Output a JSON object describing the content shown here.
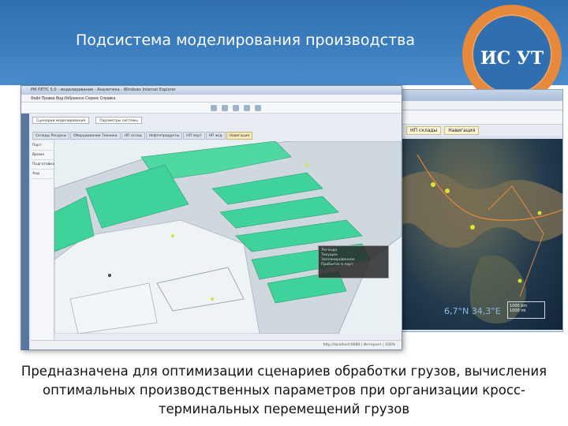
{
  "slide": {
    "title": "Подсистема моделирования производства",
    "logo_text": "ИС УТ",
    "caption": "Предназначена для оптимизации сценариев обработки грузов, вычисления оптимальных производственных параметров при организации кросс-терминальных перемещений грузов"
  },
  "colors": {
    "header_blue": "#3e7fc0",
    "logo_orange": "#e8883a",
    "map_green": "#3fd39b"
  },
  "front_window": {
    "title": "РМ ППТС 5.0 - моделирование - Аналитика - Windows Internet Explorer",
    "menu": "Файл  Правка  Вид  Избранное  Сервис  Справка",
    "toolbar_buttons": [
      "Сценарии моделирования",
      "Параметры системы"
    ],
    "tabs": [
      {
        "label": "Склады  Ресурсы",
        "active": false
      },
      {
        "label": "Оборудование  Техника",
        "active": false
      },
      {
        "label": "НП склад",
        "active": false
      },
      {
        "label": "Нефтепродукты",
        "active": false
      },
      {
        "label": "НП порт",
        "active": false
      },
      {
        "label": "НП ж/д",
        "active": false
      },
      {
        "label": "Навигация",
        "active": true
      }
    ],
    "left_nav": [
      "Порт",
      "Время",
      "Подготовка",
      "Ход"
    ],
    "legend_lines": [
      "Легенда",
      "Текущее",
      "Запланированное",
      "Прибытие в порт"
    ],
    "status": "http://localhost:8080 | Интернет | 100%"
  },
  "back_window": {
    "tabs": [
      "НП склады",
      "Навигация"
    ],
    "coords_text": "6,7°N  34,3°E",
    "scale_lines": [
      "1000 km",
      "1000 mi"
    ]
  }
}
